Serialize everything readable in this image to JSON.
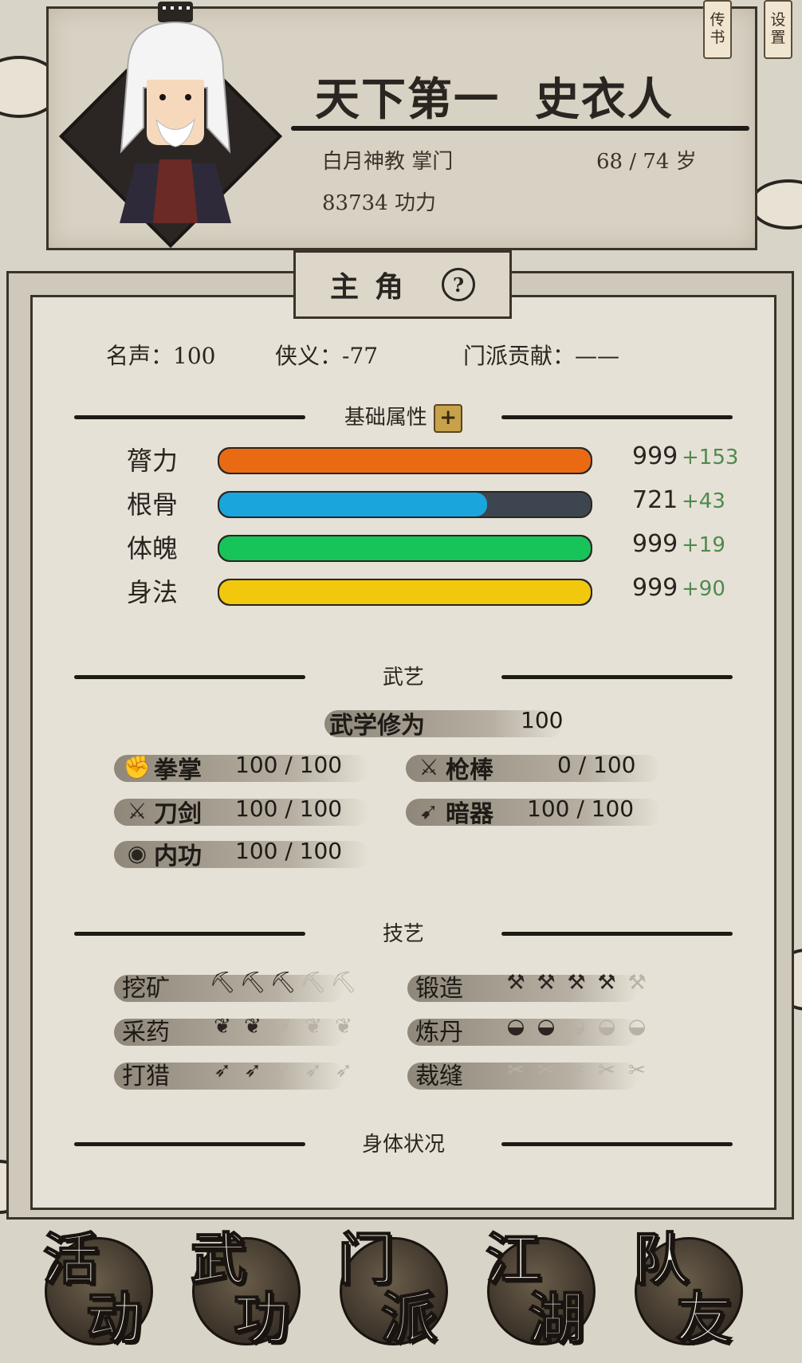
{
  "header": {
    "title_prefix": "天下第一",
    "name": "史衣人",
    "sect_role": "白月神教 掌门",
    "age": "68 / 74 岁",
    "power": "83734 功力"
  },
  "corner_tabs": {
    "letters": "传书",
    "settings": "设置"
  },
  "role_tab": {
    "label": "主角",
    "help_glyph": "?"
  },
  "stats": {
    "fame": "名声：100",
    "chivalry": "侠义：-77",
    "contribution": "门派贡献：——"
  },
  "sections": {
    "attributes": "基础属性",
    "martial": "武艺",
    "crafts": "技艺",
    "body": "身体状况"
  },
  "attributes": [
    {
      "label": "膂力",
      "value": "999",
      "bonus": "+153",
      "fill": 1.0,
      "color": "#e96a12"
    },
    {
      "label": "根骨",
      "value": "721",
      "bonus": "+43",
      "fill": 0.72,
      "color": "#1aa6dc"
    },
    {
      "label": "体魄",
      "value": "999",
      "bonus": "+19",
      "fill": 1.0,
      "color": "#17c45a"
    },
    {
      "label": "身法",
      "value": "999",
      "bonus": "+90",
      "fill": 1.0,
      "color": "#f2c80c"
    }
  ],
  "martial": {
    "cultivation_label": "武学修为",
    "cultivation_value": "100",
    "skills": [
      {
        "icon": "fist-icon",
        "name": "拳掌",
        "value": "100 / 100"
      },
      {
        "icon": "spear-icon",
        "name": "枪棒",
        "value": "0 / 100"
      },
      {
        "icon": "sword-icon",
        "name": "刀剑",
        "value": "100 / 100"
      },
      {
        "icon": "dart-icon",
        "name": "暗器",
        "value": "100 / 100"
      },
      {
        "icon": "inner-icon",
        "name": "内功",
        "value": "100 / 100"
      }
    ]
  },
  "crafts": [
    {
      "name": "挖矿",
      "icon": "pickaxe-icon",
      "glyph": "⛏",
      "level": 3,
      "max": 5
    },
    {
      "name": "锻造",
      "icon": "anvil-icon",
      "glyph": "⚒",
      "level": 4,
      "max": 5
    },
    {
      "name": "采药",
      "icon": "herb-icon",
      "glyph": "❦",
      "level": 2,
      "max": 5
    },
    {
      "name": "炼丹",
      "icon": "bowl-icon",
      "glyph": "◒",
      "level": 2,
      "max": 5
    },
    {
      "name": "打猎",
      "icon": "bow-icon",
      "glyph": "➶",
      "level": 2,
      "max": 5
    },
    {
      "name": "裁缝",
      "icon": "needle-icon",
      "glyph": "✂",
      "level": 0,
      "max": 5
    }
  ],
  "nav": [
    {
      "top": "活",
      "bottom": "动"
    },
    {
      "top": "武",
      "bottom": "功"
    },
    {
      "top": "门",
      "bottom": "派"
    },
    {
      "top": "江",
      "bottom": "湖"
    },
    {
      "top": "队",
      "bottom": "友"
    }
  ]
}
